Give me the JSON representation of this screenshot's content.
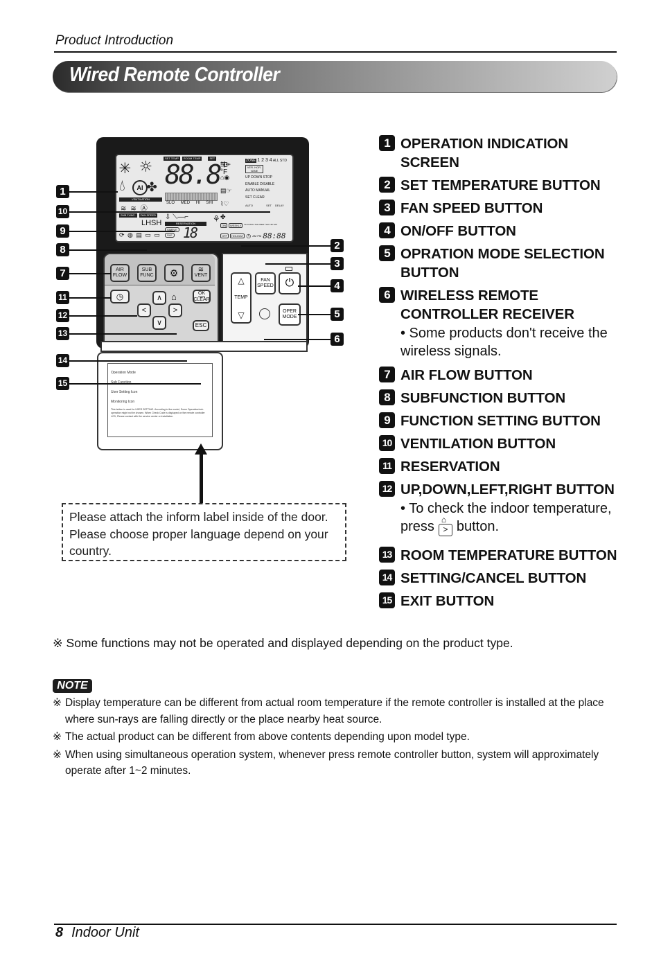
{
  "header": {
    "section": "Product Introduction",
    "title": "Wired Remote Controller"
  },
  "diagram": {
    "lcd": {
      "badges": [
        "SET TEMP",
        "ROOM TEMP",
        "SET"
      ],
      "main_digits": "88.8",
      "units": [
        "°C",
        "°F"
      ],
      "ventilation_label": "VENTILATION",
      "fan_levels": [
        "SLO",
        "MED",
        "HI",
        "SHI"
      ],
      "sub_func_label": "SUB FUNC.",
      "fan_speed_label": "FAN SPEED",
      "lhsh": "LHSH",
      "reservation_label": "RESERVATION",
      "reservation_digits": "18",
      "zone_label": "ZONE",
      "zone_numbers": "1 2 3 4",
      "all_std": "ALL STD",
      "vane_label": "VER. HOR. VANE",
      "up_down_stop": "UP DOWN STOP",
      "enable_disable": "ENABLE DISABLE",
      "auto_manual": "AUTO MANUAL",
      "set_clear": "SET CLEAR",
      "set_small": "SET",
      "delay": "DELAY",
      "auto": "AUTO",
      "on": "ON",
      "off": "OFF",
      "weekly": "WEEKLY",
      "holiday": "HOLIDAY",
      "days": "SUN MON TUE WED THU FRI SAT",
      "am_pm": "AM PM",
      "clock_digits": "88:88",
      "simple": "SIMPLE",
      "sle": "SLE"
    },
    "buttons": {
      "air_flow": "AIR FLOW",
      "sub_func": "SUB FUNC",
      "vent": "VENT",
      "ok_clear_top": "OK",
      "ok_clear_bottom": "CLEAR",
      "esc": "ESC",
      "temp": "TEMP",
      "fan_speed": "FAN SPEED",
      "oper_mode": "OPER MODE"
    },
    "label_card": {
      "rows": [
        "Operation Mode",
        "Sub Function",
        "User Setting Icon",
        "Monitoring Icon"
      ],
      "footer": "This button is used for USER SETTING. According to the model, Some Operation/sub-operation might not be chosen. When Check Code is displayed on the remote controller LCD, Please contact with the service center or installation."
    },
    "callouts_left": [
      "1",
      "10",
      "9",
      "8",
      "7",
      "11",
      "12",
      "13",
      "14",
      "15"
    ],
    "callouts_right": [
      "2",
      "3",
      "4",
      "5",
      "6"
    ],
    "note_box": "Please attach the inform label inside of the door. Please choose proper language depend on your country."
  },
  "legend": [
    {
      "num": "1",
      "label": "OPERATION INDICATION SCREEN"
    },
    {
      "num": "2",
      "label": "SET TEMPERATURE BUTTON"
    },
    {
      "num": "3",
      "label": "FAN SPEED BUTTON"
    },
    {
      "num": "4",
      "label": "ON/OFF BUTTON"
    },
    {
      "num": "5",
      "label": "OPRATION MODE SELECTION BUTTON"
    },
    {
      "num": "6",
      "label": "WIRELESS REMOTE CONTROLLER RECEIVER",
      "sub": "• Some products don't receive the wireless signals."
    },
    {
      "num": "7",
      "label": "AIR FLOW BUTTON"
    },
    {
      "num": "8",
      "label": "SUBFUNCTION BUTTON"
    },
    {
      "num": "9",
      "label": "FUNCTION SETTING BUTTON"
    },
    {
      "num": "10",
      "label": "VENTILATION BUTTON"
    },
    {
      "num": "11",
      "label": "RESERVATION"
    },
    {
      "num": "12",
      "label": "UP,DOWN,LEFT,RIGHT BUTTON",
      "sub_pre": "• To check the indoor temperature, press",
      "sub_post": "button."
    },
    {
      "num": "13",
      "label": "ROOM TEMPERATURE BUTTON"
    },
    {
      "num": "14",
      "label": "SETTING/CANCEL BUTTON"
    },
    {
      "num": "15",
      "label": "EXIT BUTTON"
    }
  ],
  "footnote": "※ Some functions may not be operated and displayed depending on the product type.",
  "note": {
    "badge": "NOTE",
    "mark": "※",
    "items": [
      "Display temperature can be different from actual room temperature if the remote controller is  installed at the place where sun-rays are falling directly or the place nearby heat source.",
      "The actual product can be different from above contents depending upon model type.",
      "When using simultaneous operation system, whenever press remote controller button, system will approximately operate after 1~2 minutes."
    ]
  },
  "footer": {
    "page_number": "8",
    "section": "Indoor Unit"
  }
}
